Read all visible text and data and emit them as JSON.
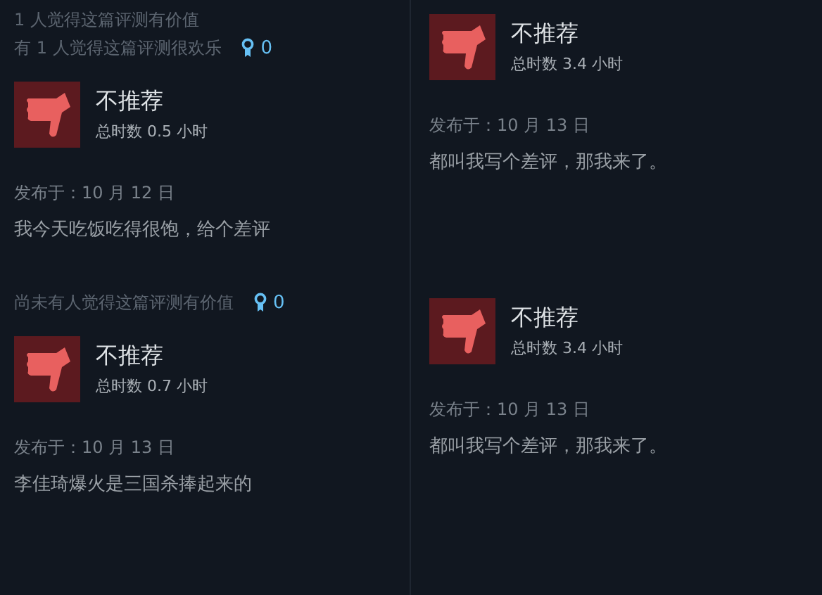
{
  "reviews": [
    {
      "helpful": [
        "1 人觉得这篇评测有价值",
        "有 1 人觉得这篇评测很欢乐"
      ],
      "award_count": "0",
      "recommended": false,
      "verdict": "不推荐",
      "hours": "总时数 0.5 小时",
      "posted": "发布于：10 月 12 日",
      "text": "我今天吃饭吃得很饱，给个差评"
    },
    {
      "recommended": false,
      "verdict": "不推荐",
      "hours": "总时数 3.4 小时",
      "posted": "发布于：10 月 13 日",
      "text": "都叫我写个差评，那我来了。"
    },
    {
      "helpful": [
        "尚未有人觉得这篇评测有价值"
      ],
      "award_count": "0",
      "recommended": false,
      "verdict": "不推荐",
      "hours": "总时数 0.7 小时",
      "posted": "发布于：10 月 13 日",
      "text": "李佳琦爆火是三国杀捧起来的"
    },
    {
      "recommended": false,
      "verdict": "不推荐",
      "hours": "总时数 3.4 小时",
      "posted": "发布于：10 月 13 日",
      "text": "都叫我写个差评，那我来了。"
    }
  ]
}
